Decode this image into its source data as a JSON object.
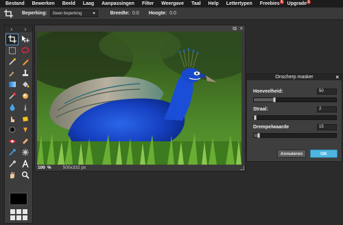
{
  "menu": {
    "items": [
      {
        "label": "Bestand"
      },
      {
        "label": "Bewerken"
      },
      {
        "label": "Beeld"
      },
      {
        "label": "Laag"
      },
      {
        "label": "Aanpassingen"
      },
      {
        "label": "Filter"
      },
      {
        "label": "Weergave"
      },
      {
        "label": "Taal"
      },
      {
        "label": "Help"
      },
      {
        "label": "Lettertypen"
      },
      {
        "label": "Freebies",
        "badge": "5"
      },
      {
        "label": "Upgrade",
        "badge": "1"
      }
    ]
  },
  "options_bar": {
    "tool_icon": "crop-icon",
    "feather_label": "Beperking:",
    "feather_value": "Geen beperking",
    "width_label": "Breedte:",
    "width_value": "0.0",
    "height_label": "Hoogte:",
    "height_value": "0.0"
  },
  "toolbox": {
    "nav_left": "‹",
    "nav_right": "›",
    "tools": [
      "crop-icon",
      "move-icon",
      "marquee-icon",
      "lasso-icon",
      "wand-icon",
      "pencil-icon",
      "brush-icon",
      "clone-stamp-icon",
      "gradient-icon",
      "paint-bucket-icon",
      "eyedropper-icon",
      "heal-icon",
      "drop-icon",
      "dodge-icon",
      "finger-icon",
      "sponge-icon",
      "burn-icon",
      "fill-icon",
      "eye-icon",
      "bandage-icon",
      "pinch-icon",
      "sharpen-icon",
      "color-picker-icon",
      "text-icon",
      "hand-icon",
      "zoom-icon"
    ],
    "foreground_color": "#000000"
  },
  "image_window": {
    "zoom_value": "100",
    "zoom_unit": "%",
    "dimensions": "500x332 px",
    "controls": [
      "restore-icon",
      "close-icon"
    ]
  },
  "dialog": {
    "title": "Onscherp masker",
    "close": "×",
    "params": [
      {
        "label": "Hoeveelheid:",
        "value": "50",
        "fraction": 0.25
      },
      {
        "label": "Straal:",
        "value": "2",
        "fraction": 0.02
      },
      {
        "label": "Drempelwaarde",
        "value": "15",
        "fraction": 0.06
      }
    ],
    "cancel_label": "Annuleren",
    "ok_label": "OK"
  },
  "colors": {
    "accent": "#4fb6e0",
    "badge": "#d9342b",
    "peacock_blue": "#1545c8",
    "grass": "#3d7a1f"
  }
}
